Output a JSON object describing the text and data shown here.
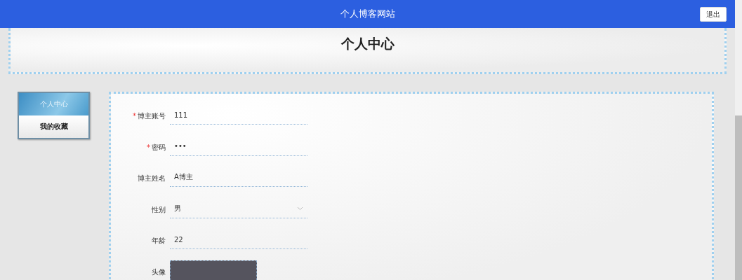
{
  "header": {
    "title": "个人博客网站",
    "logout_button": "退出"
  },
  "page_title": "个人中心",
  "sidebar": {
    "items": [
      {
        "label": "个人中心",
        "selected": true
      },
      {
        "label": "我的收藏",
        "selected": false
      }
    ]
  },
  "form": {
    "fields": [
      {
        "kind": "text",
        "label": "博主账号",
        "required_mark": "*",
        "value": "111"
      },
      {
        "kind": "text",
        "label": "密码",
        "required_mark": "*",
        "value": "•••"
      },
      {
        "kind": "text",
        "label": "博主姓名",
        "value": "A博主"
      },
      {
        "kind": "select",
        "label": "性别",
        "value": "男"
      },
      {
        "kind": "text",
        "label": "年龄",
        "value": "22"
      },
      {
        "kind": "photo",
        "label": "头像"
      }
    ]
  }
}
